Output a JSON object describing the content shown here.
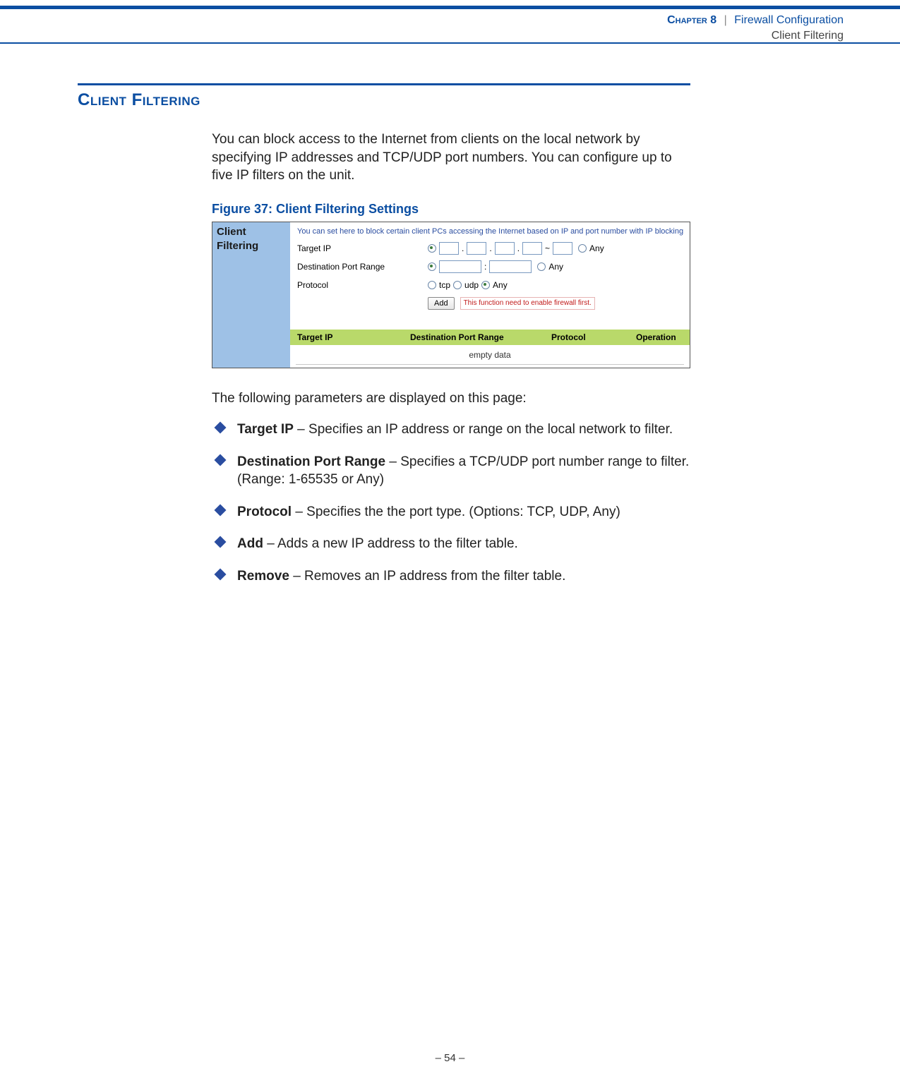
{
  "header": {
    "chapter_label": "Chapter 8",
    "separator": "|",
    "chapter_title": "Firewall Configuration",
    "subsection": "Client Filtering"
  },
  "section": {
    "title": "Client Filtering",
    "intro": "You can block access to the Internet from clients on the local network by specifying IP addresses and TCP/UDP port numbers. You can configure up to five IP filters on the unit."
  },
  "figure": {
    "caption": "Figure 37:  Client Filtering Settings",
    "side_label": "Client Filtering",
    "intro_line": "You can set here to block certain client PCs accessing the Internet based on IP and port number with IP blocking",
    "row_labels": {
      "target_ip": "Target IP",
      "dest_port_range": "Destination Port Range",
      "protocol": "Protocol"
    },
    "ip_sep_dot": ".",
    "ip_sep_tilde": "~",
    "port_sep": ":",
    "any_label": "Any",
    "proto_tcp": "tcp",
    "proto_udp": "udp",
    "add_button": "Add",
    "warn_text": "This function need to enable firewall first.",
    "table_headers": {
      "c1": "Target IP",
      "c2": "Destination Port Range",
      "c3": "Protocol",
      "c4": "Operation"
    },
    "empty_text": "empty data"
  },
  "followup": "The following parameters are displayed on this page:",
  "params": [
    {
      "term": "Target IP",
      "desc": " – Specifies an IP address or range on the local network to filter."
    },
    {
      "term": "Destination Port Range",
      "desc": " – Specifies a TCP/UDP port number range to filter. (Range: 1-65535 or Any)"
    },
    {
      "term": "Protocol",
      "desc": " – Specifies the the port type. (Options: TCP, UDP, Any)"
    },
    {
      "term": "Add",
      "desc": " – Adds a new IP address to the filter table."
    },
    {
      "term": "Remove",
      "desc": " – Removes an IP address from the filter table."
    }
  ],
  "page_number": "–  54  –"
}
